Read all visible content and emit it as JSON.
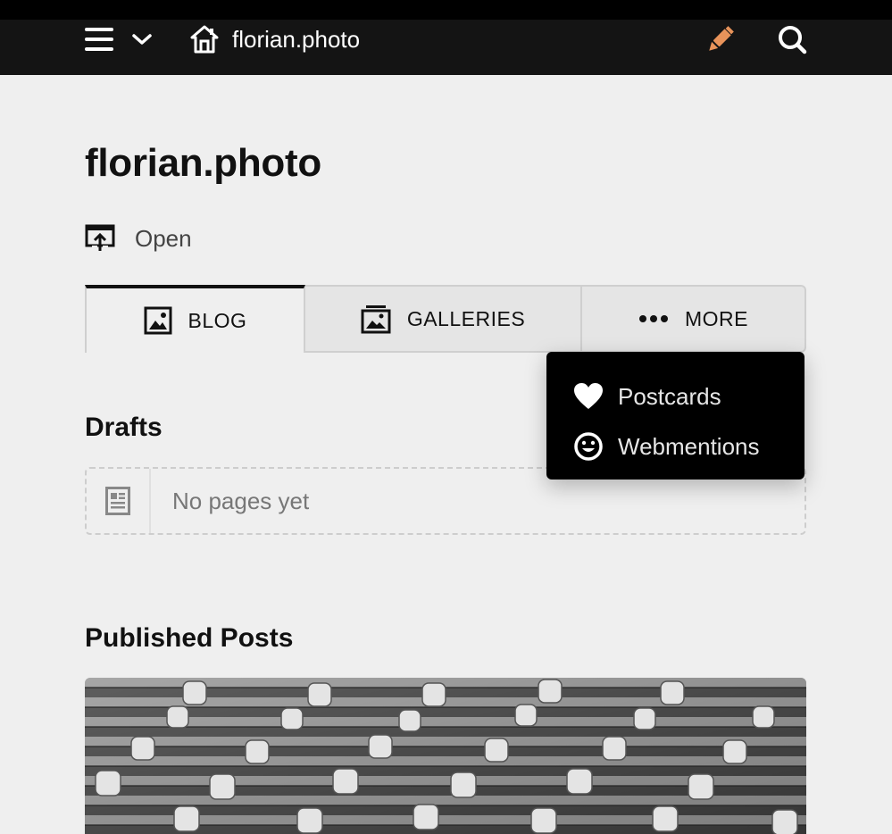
{
  "topbar": {
    "site_title": "florian.photo",
    "icons": {
      "menu": "hamburger-icon",
      "dropdown": "chevron-down-icon",
      "home": "home-icon",
      "edit": "pencil-icon",
      "search": "search-icon"
    },
    "colors": {
      "background": "#141414",
      "edit_accent": "#e8935a"
    }
  },
  "page": {
    "title": "florian.photo",
    "open_label": "Open"
  },
  "tabs": [
    {
      "label": "BLOG",
      "icon": "image-icon",
      "active": true
    },
    {
      "label": "GALLERIES",
      "icon": "gallery-stack-icon",
      "active": false
    },
    {
      "label": "MORE",
      "icon": "dots-icon",
      "active": false
    }
  ],
  "more_menu": [
    {
      "label": "Postcards",
      "icon": "heart-icon"
    },
    {
      "label": "Webmentions",
      "icon": "smiley-icon"
    }
  ],
  "drafts": {
    "heading": "Drafts",
    "empty_text": "No pages yet"
  },
  "published": {
    "heading": "Published Posts"
  }
}
